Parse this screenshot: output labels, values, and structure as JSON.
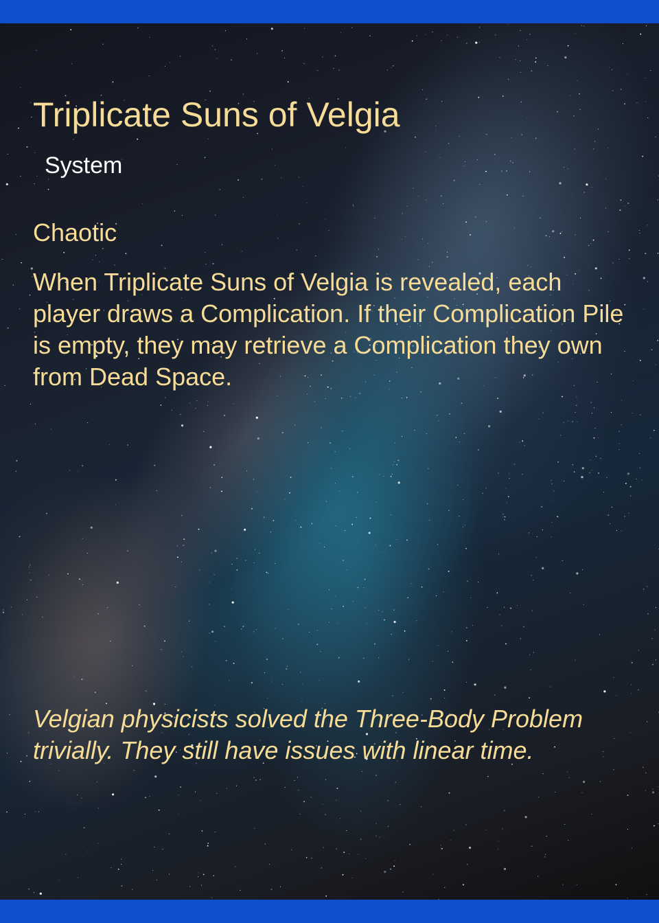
{
  "card": {
    "title": "Triplicate Suns of Velgia",
    "type": "System",
    "keyword": "Chaotic",
    "rules_text": "When Triplicate Suns of Velgia is revealed, each player draws a Complication. If their Complication Pile is empty, they may retrieve a Complication they own from Dead Space.",
    "flavor_text": "Velgian physicists solved the Three-Body Problem trivially. They still have issues with linear time."
  },
  "colors": {
    "frame": "#0f4fce",
    "text_gold": "#f7dc97",
    "type_white": "#ffffff"
  },
  "background": {
    "image": "starry-sky-milky-way"
  }
}
